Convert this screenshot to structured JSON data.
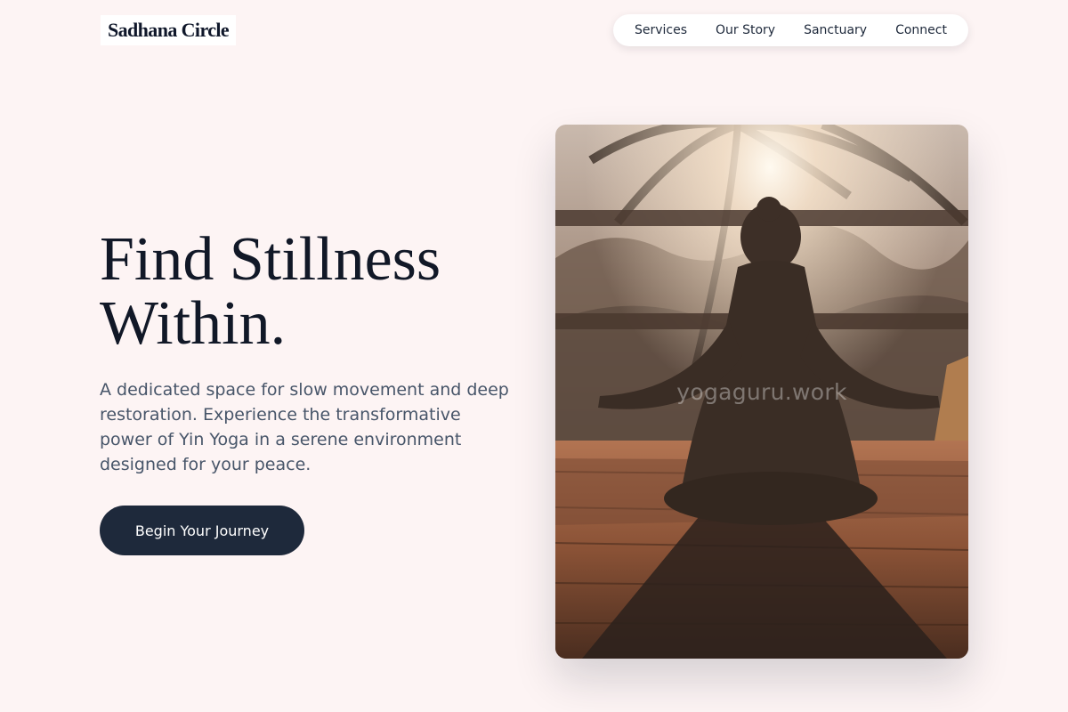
{
  "brand": {
    "name": "Sadhana Circle"
  },
  "nav": {
    "items": [
      {
        "label": "Services"
      },
      {
        "label": "Our Story"
      },
      {
        "label": "Sanctuary"
      },
      {
        "label": "Connect"
      }
    ]
  },
  "hero": {
    "title_line1": "Find Stillness",
    "title_line2": "Within.",
    "description": "A dedicated space for slow movement and deep restoration. Experience the transformative power of Yin Yoga in a serene environment designed for your peace.",
    "cta_label": "Begin Your Journey",
    "image": {
      "icon": "meditation-photo",
      "watermark": "yogaguru.work"
    }
  },
  "colors": {
    "background": "#fdf4f4",
    "text_dark": "#111827",
    "text_muted": "#475569",
    "button_bg": "#1e293b",
    "button_text": "#ffffff"
  }
}
